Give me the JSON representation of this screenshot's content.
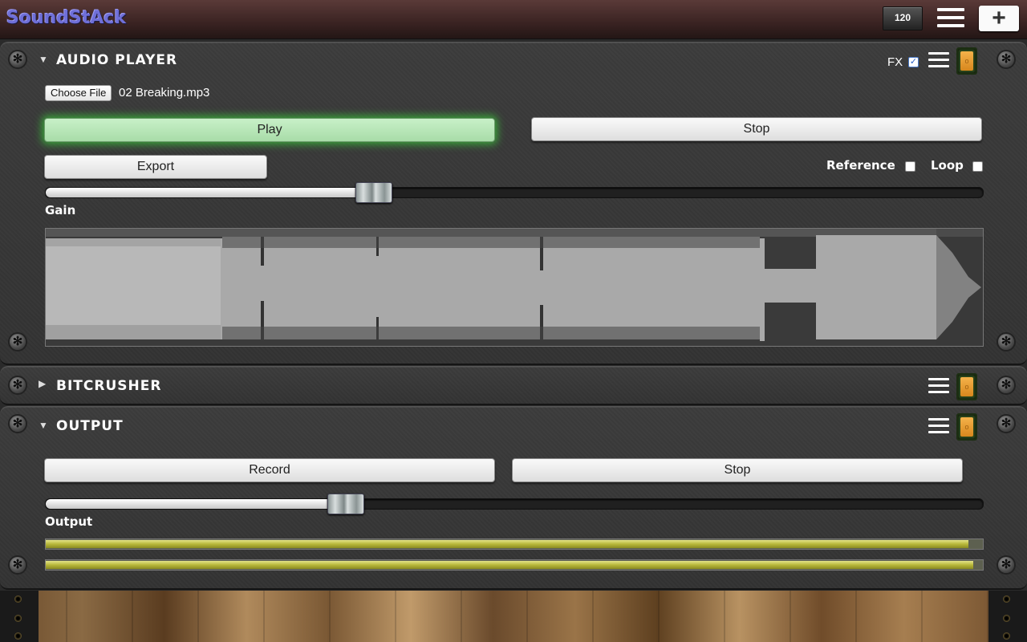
{
  "app": {
    "logo": "SoundStAck",
    "bpm": "120"
  },
  "audio_player": {
    "title": "AUDIO PLAYER",
    "fx_label": "FX",
    "fx_checked": true,
    "choose_file_label": "Choose File",
    "file_name": "02 Breaking.mp3",
    "play_label": "Play",
    "stop_label": "Stop",
    "export_label": "Export",
    "reference_label": "Reference",
    "loop_label": "Loop",
    "gain_label": "Gain",
    "gain_level": 0.35,
    "playhead_fraction": 0.187
  },
  "bitcrusher": {
    "title": "BITCRUSHER"
  },
  "output": {
    "title": "OUTPUT",
    "record_label": "Record",
    "stop_label": "Stop",
    "output_label": "Output",
    "output_level": 0.32,
    "meter_left": 0.985,
    "meter_right": 0.99
  },
  "colors": {
    "play_glow": "#3aa43a",
    "meter": "#c4c444",
    "power": "#e49a2c"
  }
}
